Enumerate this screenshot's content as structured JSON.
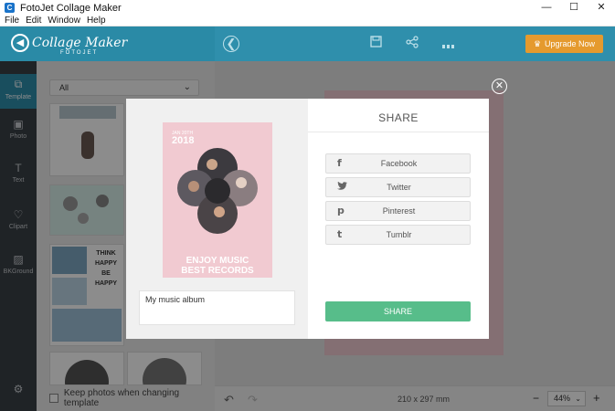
{
  "window": {
    "title": "FotoJet Collage Maker",
    "minimize": "—",
    "maximize": "☐",
    "close": "✕"
  },
  "menu": [
    "File",
    "Edit",
    "Window",
    "Help"
  ],
  "header": {
    "logo_name": "Collage Maker",
    "logo_sub": "FOTOJET",
    "upgrade_label": "Upgrade Now"
  },
  "sidebar": {
    "items": [
      {
        "label": "Template",
        "icon": "template-icon"
      },
      {
        "label": "Photo",
        "icon": "photo-icon"
      },
      {
        "label": "Text",
        "icon": "text-icon"
      },
      {
        "label": "Clipart",
        "icon": "clipart-icon"
      },
      {
        "label": "BKGround",
        "icon": "background-icon"
      }
    ],
    "settings_icon": "gear-icon"
  },
  "templates": {
    "filter_value": "All",
    "keep_photos_label": "Keep photos when changing template"
  },
  "bottombar": {
    "dimensions": "210 x 297 mm",
    "zoom": "44%"
  },
  "share_dialog": {
    "title": "SHARE",
    "caption": "My music album",
    "poster": {
      "date": "JAN 20TH",
      "year": "2018",
      "title_line1": "ENJOY MUSIC",
      "title_line2": "BEST RECORDS"
    },
    "networks": [
      {
        "label": "Facebook",
        "icon": "facebook-icon",
        "glyph": "f"
      },
      {
        "label": "Twitter",
        "icon": "twitter-icon",
        "glyph": "🐦"
      },
      {
        "label": "Pinterest",
        "icon": "pinterest-icon",
        "glyph": "p"
      },
      {
        "label": "Tumblr",
        "icon": "tumblr-icon",
        "glyph": "t"
      }
    ],
    "share_button": "SHARE"
  },
  "colors": {
    "brand_teal": "#2f8fac",
    "upgrade_orange": "#e59a2e",
    "share_green": "#57bd8a",
    "poster_pink": "#f1cad1",
    "sidebar_dark": "#3a4046"
  }
}
